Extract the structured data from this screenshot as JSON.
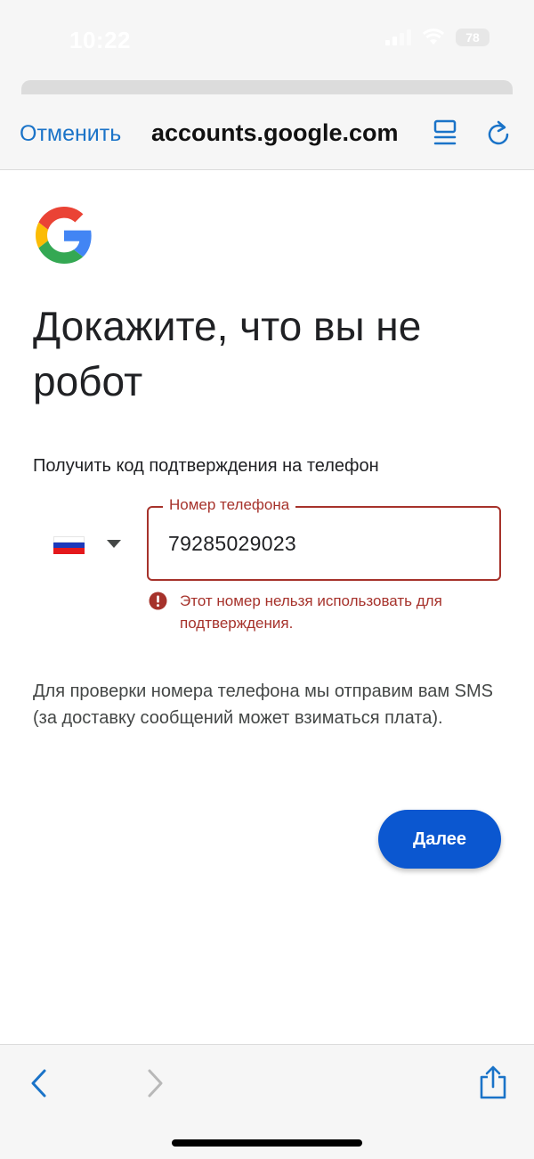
{
  "status_bar": {
    "time": "10:22",
    "battery": "78"
  },
  "header": {
    "cancel_label": "Отменить",
    "site": "accounts.google.com"
  },
  "page": {
    "title": "Докажите, что вы не робот",
    "subtitle": "Получить код подтверждения на телефон",
    "phone_field": {
      "label": "Номер телефона",
      "value": "79285029023",
      "country": "Russia"
    },
    "error": "Этот номер нельзя использовать для подтверждения.",
    "info": "Для проверки номера телефона мы отправим вам SMS (за доставку сообщений может взиматься плата).",
    "next_label": "Далее"
  },
  "colors": {
    "link_blue": "#1a73c8",
    "error_red": "#a6322b",
    "button_blue": "#0b57d0"
  },
  "icons": [
    "google-logo-icon",
    "reader-icon",
    "reload-icon",
    "flag-ru-icon",
    "chevron-down-icon",
    "error-icon",
    "back-icon",
    "forward-icon",
    "share-icon"
  ]
}
